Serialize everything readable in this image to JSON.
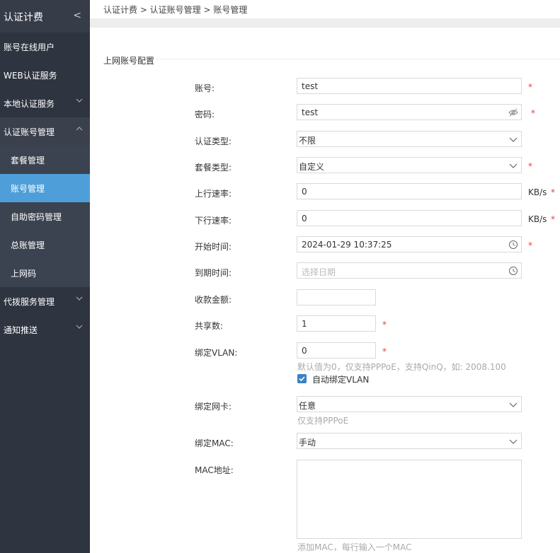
{
  "sidebar": {
    "title": "认证计费",
    "items": [
      {
        "label": "账号在线用户"
      },
      {
        "label": "WEB认证服务"
      },
      {
        "label": "本地认证服务"
      },
      {
        "label": "认证账号管理"
      },
      {
        "label": "套餐管理"
      },
      {
        "label": "账号管理"
      },
      {
        "label": "自助密码管理"
      },
      {
        "label": "总账管理"
      },
      {
        "label": "上网码"
      },
      {
        "label": "代拨服务管理"
      },
      {
        "label": "通知推送"
      }
    ]
  },
  "breadcrumb": "认证计费 > 认证账号管理 > 账号管理",
  "section_title": "上网账号配置",
  "form": {
    "account": {
      "label": "账号:",
      "value": "test"
    },
    "password": {
      "label": "密码:",
      "value": "test"
    },
    "auth_type": {
      "label": "认证类型:",
      "value": "不限"
    },
    "package_type": {
      "label": "套餐类型:",
      "value": "自定义"
    },
    "up_rate": {
      "label": "上行速率:",
      "value": "0",
      "unit": "KB/s"
    },
    "down_rate": {
      "label": "下行速率:",
      "value": "0",
      "unit": "KB/s"
    },
    "start_time": {
      "label": "开始时间:",
      "value": "2024-01-29 10:37:25"
    },
    "expire_time": {
      "label": "到期时间:",
      "placeholder": "选择日期"
    },
    "amount": {
      "label": "收款金额:",
      "value": ""
    },
    "share_count": {
      "label": "共享数:",
      "value": "1"
    },
    "vlan": {
      "label": "绑定VLAN:",
      "value": "0",
      "hint": "默认值为0，仅支持PPPoE，支持QinQ，如: 2008.100"
    },
    "auto_vlan": {
      "label": "自动绑定VLAN",
      "checked": true
    },
    "nic": {
      "label": "绑定网卡:",
      "value": "任意",
      "hint": "仅支持PPPoE"
    },
    "mac_bind": {
      "label": "绑定MAC:",
      "value": "手动"
    },
    "mac_address": {
      "label": "MAC地址:",
      "value": "",
      "hint": "添加MAC，每行输入一个MAC"
    }
  },
  "required_mark": "*",
  "colors": {
    "sidebar_bg": "#2e3440",
    "active": "#4e9fd9",
    "required": "#e53e3e",
    "checkbox": "#3b82c4"
  }
}
